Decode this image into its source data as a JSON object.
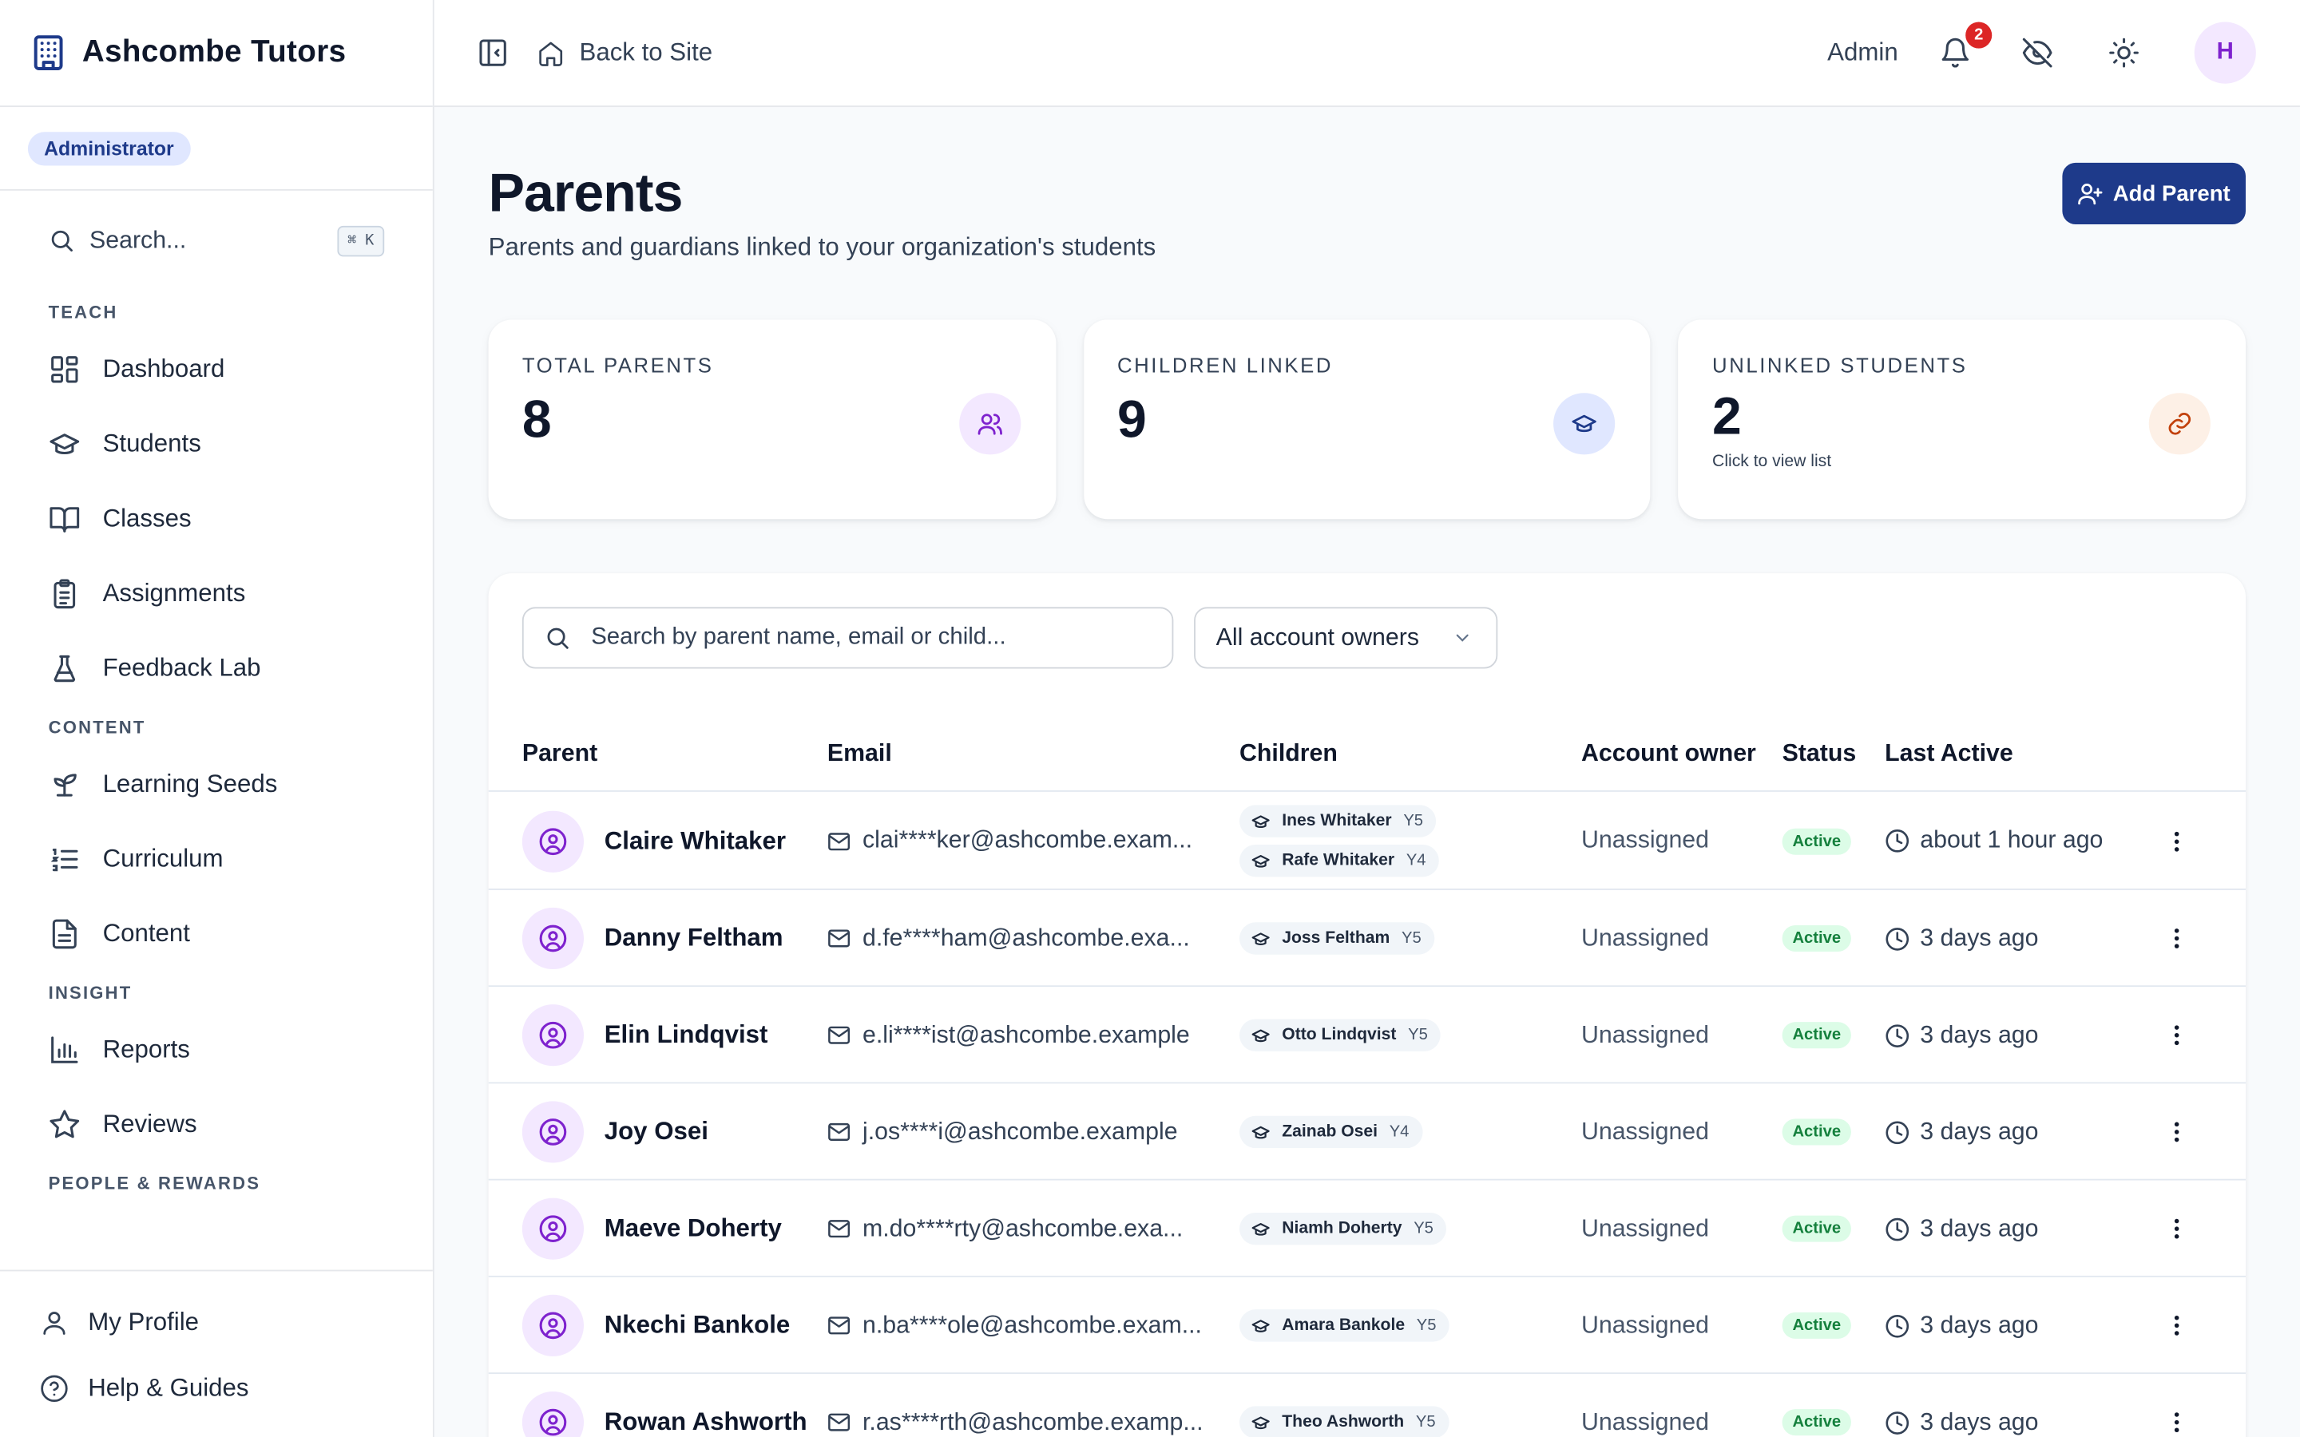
{
  "brand": {
    "name": "Ashcombe Tutors"
  },
  "role_badge": "Administrator",
  "sidebar": {
    "search_label": "Search...",
    "search_shortcut": "⌘ K",
    "sections": [
      {
        "label": "TEACH",
        "items": [
          {
            "label": "Dashboard",
            "icon": "dashboard-icon"
          },
          {
            "label": "Students",
            "icon": "graduation-cap-icon"
          },
          {
            "label": "Classes",
            "icon": "book-open-icon"
          },
          {
            "label": "Assignments",
            "icon": "clipboard-list-icon"
          },
          {
            "label": "Feedback Lab",
            "icon": "flask-icon"
          }
        ]
      },
      {
        "label": "CONTENT",
        "items": [
          {
            "label": "Learning Seeds",
            "icon": "sprout-icon"
          },
          {
            "label": "Curriculum",
            "icon": "list-ordered-icon"
          },
          {
            "label": "Content",
            "icon": "file-text-icon"
          }
        ]
      },
      {
        "label": "INSIGHT",
        "items": [
          {
            "label": "Reports",
            "icon": "bar-chart-icon"
          },
          {
            "label": "Reviews",
            "icon": "star-icon"
          }
        ]
      },
      {
        "label": "PEOPLE & REWARDS",
        "items": []
      }
    ],
    "bottom": [
      {
        "label": "My Profile",
        "icon": "user-icon"
      },
      {
        "label": "Help & Guides",
        "icon": "help-circle-icon"
      }
    ]
  },
  "topbar": {
    "back_label": "Back to Site",
    "admin_label": "Admin",
    "notification_count": "2",
    "avatar_initial": "H"
  },
  "page": {
    "title": "Parents",
    "subtitle": "Parents and guardians linked to your organization's students",
    "add_button": "Add Parent"
  },
  "stats": [
    {
      "label": "TOTAL PARENTS",
      "value": "8",
      "hint": "",
      "icon": "users-icon",
      "color": "#7e22ce",
      "bg": "#f3e8ff"
    },
    {
      "label": "CHILDREN LINKED",
      "value": "9",
      "hint": "",
      "icon": "graduation-cap-icon",
      "color": "#1e3a8a",
      "bg": "#e0e7ff"
    },
    {
      "label": "UNLINKED STUDENTS",
      "value": "2",
      "hint": "Click to view list",
      "icon": "link-icon",
      "color": "#c2410c",
      "bg": "#fdf0e6"
    }
  ],
  "filters": {
    "search_placeholder": "Search by parent name, email or child...",
    "owner_select": "All account owners"
  },
  "table": {
    "columns": [
      "Parent",
      "Email",
      "Children",
      "Account owner",
      "Status",
      "Last Active"
    ],
    "rows": [
      {
        "name": "Claire Whitaker",
        "email": "clai****ker@ashcombe.exam...",
        "children": [
          {
            "name": "Ines Whitaker",
            "year": "Y5"
          },
          {
            "name": "Rafe Whitaker",
            "year": "Y4"
          }
        ],
        "owner": "Unassigned",
        "status": "Active",
        "last_active": "about 1 hour ago"
      },
      {
        "name": "Danny Feltham",
        "email": "d.fe****ham@ashcombe.exa...",
        "children": [
          {
            "name": "Joss Feltham",
            "year": "Y5"
          }
        ],
        "owner": "Unassigned",
        "status": "Active",
        "last_active": "3 days ago"
      },
      {
        "name": "Elin Lindqvist",
        "email": "e.li****ist@ashcombe.example",
        "children": [
          {
            "name": "Otto Lindqvist",
            "year": "Y5"
          }
        ],
        "owner": "Unassigned",
        "status": "Active",
        "last_active": "3 days ago"
      },
      {
        "name": "Joy Osei",
        "email": "j.os****i@ashcombe.example",
        "children": [
          {
            "name": "Zainab Osei",
            "year": "Y4"
          }
        ],
        "owner": "Unassigned",
        "status": "Active",
        "last_active": "3 days ago"
      },
      {
        "name": "Maeve Doherty",
        "email": "m.do****rty@ashcombe.exa...",
        "children": [
          {
            "name": "Niamh Doherty",
            "year": "Y5"
          }
        ],
        "owner": "Unassigned",
        "status": "Active",
        "last_active": "3 days ago"
      },
      {
        "name": "Nkechi Bankole",
        "email": "n.ba****ole@ashcombe.exam...",
        "children": [
          {
            "name": "Amara Bankole",
            "year": "Y5"
          }
        ],
        "owner": "Unassigned",
        "status": "Active",
        "last_active": "3 days ago"
      },
      {
        "name": "Rowan Ashworth",
        "email": "r.as****rth@ashcombe.examp...",
        "children": [
          {
            "name": "Theo Ashworth",
            "year": "Y5"
          }
        ],
        "owner": "Unassigned",
        "status": "Active",
        "last_active": "3 days ago"
      }
    ]
  }
}
